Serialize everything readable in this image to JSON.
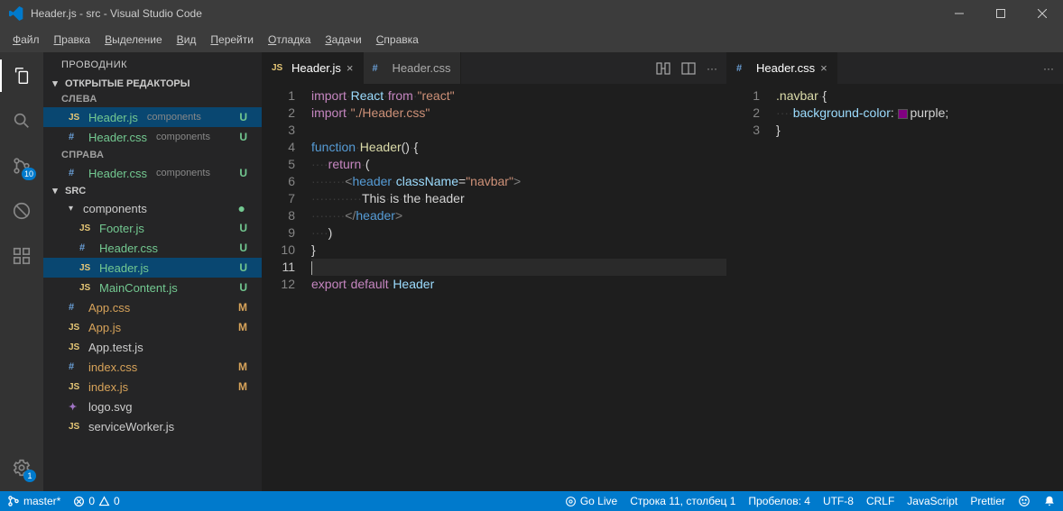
{
  "window": {
    "title": "Header.js - src - Visual Studio Code"
  },
  "menus": [
    "Файл",
    "Правка",
    "Выделение",
    "Вид",
    "Перейти",
    "Отладка",
    "Задачи",
    "Справка"
  ],
  "activity": {
    "scm_badge": "10",
    "settings_badge": "1"
  },
  "sidebar": {
    "title": "ПРОВОДНИК",
    "open_editors": "ОТКРЫТЫЕ РЕДАКТОРЫ",
    "group_left": "СЛЕВА",
    "group_right": "СПРАВА",
    "open_left": [
      {
        "icon": "js",
        "name": "Header.js",
        "path": "components",
        "badge": "U",
        "badgeClass": "",
        "nameClass": "green"
      },
      {
        "icon": "css",
        "name": "Header.css",
        "path": "components",
        "badge": "U",
        "badgeClass": "",
        "nameClass": "green"
      }
    ],
    "open_right": [
      {
        "icon": "css",
        "name": "Header.css",
        "path": "components",
        "badge": "U",
        "badgeClass": "",
        "nameClass": "green"
      }
    ],
    "root": "SRC",
    "folder_components": "components",
    "files_components": [
      {
        "icon": "js",
        "name": "Footer.js",
        "badge": "U",
        "nameClass": "green"
      },
      {
        "icon": "css",
        "name": "Header.css",
        "badge": "U",
        "nameClass": "green"
      },
      {
        "icon": "js",
        "name": "Header.js",
        "badge": "U",
        "nameClass": "green",
        "selected": true
      },
      {
        "icon": "js",
        "name": "MainContent.js",
        "badge": "U",
        "nameClass": "green"
      }
    ],
    "files_root": [
      {
        "icon": "css",
        "name": "App.css",
        "badge": "M",
        "nameClass": "orange",
        "badgeClass": "m"
      },
      {
        "icon": "js",
        "name": "App.js",
        "badge": "M",
        "nameClass": "orange",
        "badgeClass": "m"
      },
      {
        "icon": "js",
        "name": "App.test.js",
        "badge": "",
        "nameClass": ""
      },
      {
        "icon": "css",
        "name": "index.css",
        "badge": "M",
        "nameClass": "orange",
        "badgeClass": "m"
      },
      {
        "icon": "js",
        "name": "index.js",
        "badge": "M",
        "nameClass": "orange",
        "badgeClass": "m"
      },
      {
        "icon": "svg",
        "name": "logo.svg",
        "badge": "",
        "nameClass": ""
      },
      {
        "icon": "js",
        "name": "serviceWorker.js",
        "badge": "",
        "nameClass": ""
      }
    ]
  },
  "tabs_left": [
    {
      "icon": "js",
      "name": "Header.js",
      "active": true,
      "close": true
    },
    {
      "icon": "css",
      "name": "Header.css",
      "active": false,
      "close": false
    }
  ],
  "tabs_right": [
    {
      "icon": "css",
      "name": "Header.css",
      "active": true,
      "close": true
    }
  ],
  "editor_left": {
    "lines": [
      {
        "n": 1,
        "html": "<span class='kw'>import</span><span class='whitespace'>·</span><span class='id'>React</span><span class='whitespace'>·</span><span class='kw'>from</span><span class='whitespace'>·</span><span class='str'>&quot;react&quot;</span>"
      },
      {
        "n": 2,
        "html": "<span class='kw'>import</span><span class='whitespace'>·</span><span class='str'>&quot;./Header.css&quot;</span>"
      },
      {
        "n": 3,
        "html": ""
      },
      {
        "n": 4,
        "html": "<span class='tagn'>function</span><span class='whitespace'>·</span><span class='fn'>Header</span><span class='def'>()</span><span class='whitespace'>·</span><span class='def'>{</span>"
      },
      {
        "n": 5,
        "html": "<span class='whitespace'>····</span><span class='kw'>return</span><span class='whitespace'>·</span><span class='def'>(</span>"
      },
      {
        "n": 6,
        "html": "<span class='whitespace'>········</span><span class='tag'>&lt;</span><span class='tagn'>header</span><span class='whitespace'>·</span><span class='attr'>className</span><span class='def'>=</span><span class='attrv'>&quot;navbar&quot;</span><span class='tag'>&gt;</span>"
      },
      {
        "n": 7,
        "html": "<span class='whitespace'>············</span><span class='def'>This</span><span class='whitespace'>·</span><span class='def'>is</span><span class='whitespace'>·</span><span class='def'>the</span><span class='whitespace'>·</span><span class='def'>header</span>"
      },
      {
        "n": 8,
        "html": "<span class='whitespace'>········</span><span class='tag'>&lt;/</span><span class='tagn'>header</span><span class='tag'>&gt;</span>"
      },
      {
        "n": 9,
        "html": "<span class='whitespace'>····</span><span class='def'>)</span>"
      },
      {
        "n": 10,
        "html": "<span class='def'>}</span>"
      },
      {
        "n": 11,
        "html": "<span class='cursor-caret'></span>",
        "current": true
      },
      {
        "n": 12,
        "html": "<span class='kw'>export</span><span class='whitespace'>·</span><span class='kw'>default</span><span class='whitespace'>·</span><span class='id'>Header</span>"
      }
    ]
  },
  "editor_right": {
    "lines": [
      {
        "n": 1,
        "html": "<span class='fn'>.navbar</span><span class='whitespace'>·</span><span class='def'>{</span>"
      },
      {
        "n": 2,
        "html": "<span class='whitespace'>····</span><span class='prop'>background-color</span><span class='def'>:</span><span class='whitespace'>·</span><span class='colorbox'></span><span class='val'>purple</span><span class='def'>;</span>"
      },
      {
        "n": 3,
        "html": "<span class='def'>}</span>"
      }
    ]
  },
  "status": {
    "branch": "master*",
    "errors": "0",
    "warnings": "0",
    "golive": "Go Live",
    "position": "Строка 11, столбец 1",
    "spaces": "Пробелов: 4",
    "encoding": "UTF-8",
    "eol": "CRLF",
    "lang": "JavaScript",
    "prettier": "Prettier"
  }
}
